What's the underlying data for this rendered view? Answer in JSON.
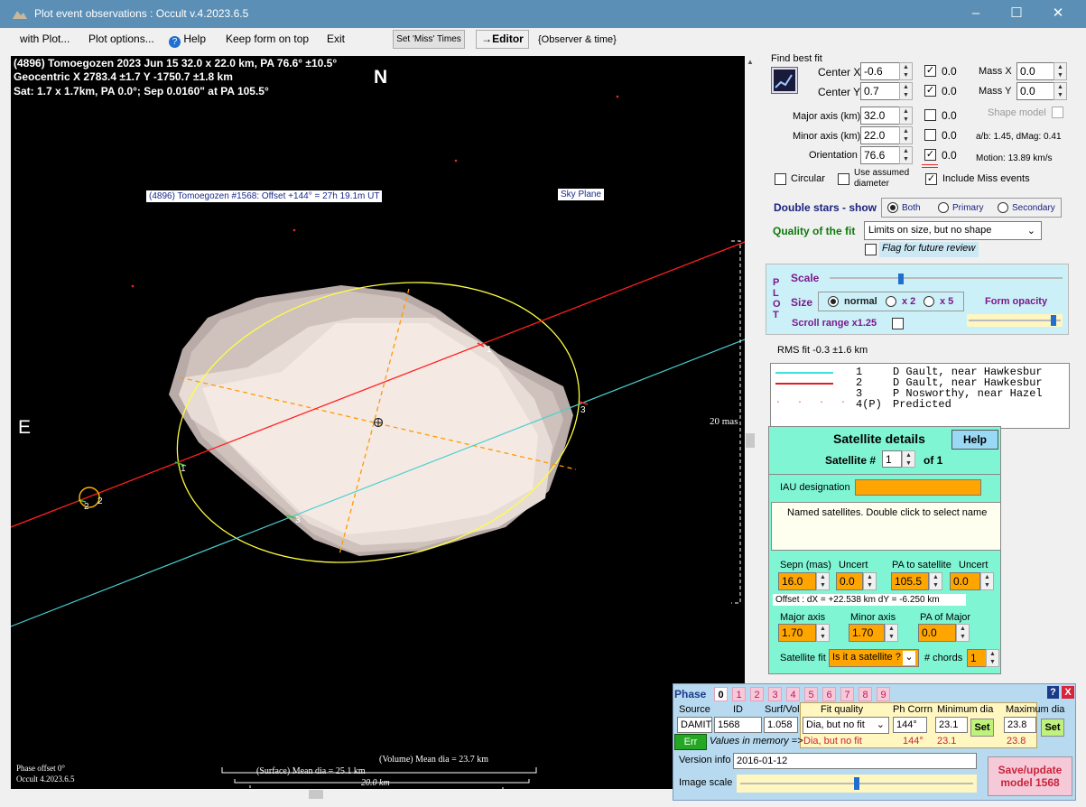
{
  "window": {
    "title": "Plot event observations : Occult v.4.2023.6.5"
  },
  "menu": {
    "with_plot": "with Plot...",
    "plot_options": "Plot options...",
    "help": "Help",
    "keep_form": "Keep form on top",
    "exit": "Exit",
    "set_miss_times": "Set 'Miss' Times",
    "editor": "→Editor",
    "observer_time": "{Observer & time}"
  },
  "plot": {
    "header_line1": "(4896) Tomoegozen  2023 Jun 15   32.0 x 22.0 km,  PA 76.6° ±10.5°",
    "header_line2": "Geocentric  X  2783.4 ±1.7  Y -1750.7 ±1.8 km",
    "header_line3": "Sat:  1.7 x 1.7km, PA 0.0°; Sep 0.0160\" at PA 105.5°",
    "north": "N",
    "east": "E",
    "shape_label": "(4896) Tomoegozen #1568: Offset +144° = 27h 19.1m UT",
    "sky_plane": "Sky Plane",
    "scale_mas": "20 mas",
    "chord_labels": [
      "1",
      "1",
      "2",
      "2",
      "3",
      "3"
    ],
    "phase_offset": "Phase offset 0°",
    "occult_version": "Occult 4.2023.6.5",
    "volume_dia": "(Volume) Mean dia = 23.7 km",
    "surface_dia": "(Surface) Mean dia = 25.1 km",
    "scale_km": "20.0 km",
    "colors": {
      "chord1": "#40e0d0",
      "chord2": "#ff2020",
      "ellipse": "#ffff40",
      "axis": "#ff9900",
      "shape": "#e2d6d0"
    }
  },
  "fit": {
    "title": "Find best fit",
    "center_x_label": "Center X",
    "center_x": "-0.6",
    "center_x_val": "0.0",
    "center_y_label": "Center Y",
    "center_y": "0.7",
    "center_y_val": "0.0",
    "major_label": "Major axis (km)",
    "major": "32.0",
    "major_val": "0.0",
    "minor_label": "Minor axis (km)",
    "minor": "22.0",
    "minor_val": "0.0",
    "orient_label": "Orientation",
    "orient": "76.6",
    "orient_val": "0.0",
    "mass_x_label": "Mass X",
    "mass_x": "0.0",
    "mass_y_label": "Mass Y",
    "mass_y": "0.0",
    "shape_model": "Shape model",
    "ab_info": "a/b: 1.45, dMag: 0.41",
    "motion": "Motion: 13.89 km/s",
    "circular": "Circular",
    "use_assumed": "Use assumed diameter",
    "include_miss": "Include Miss events",
    "double_stars": "Double stars - show",
    "both": "Both",
    "primary": "Primary",
    "secondary": "Secondary",
    "quality_label": "Quality of the fit",
    "quality_value": "Limits on size, but no shape",
    "flag_review": "Flag for future review"
  },
  "plotpanel": {
    "side": [
      "P",
      "L",
      "O",
      "T"
    ],
    "scale": "Scale",
    "size": "Size",
    "normal": "normal",
    "x2": "x 2",
    "x5": "x 5",
    "form_opacity": "Form opacity",
    "scroll_range": "Scroll range x1.25",
    "scale_pos": 0.3,
    "opacity_pos": 0.95
  },
  "rms": "RMS fit -0.3 ±1.6 km",
  "legend": [
    {
      "n": "1",
      "text": "D Gault, near Hawkesbur",
      "style": "cyan"
    },
    {
      "n": "2",
      "text": "D Gault, near Hawkesbur",
      "style": "red"
    },
    {
      "n": "3",
      "text": "P Nosworthy, near Hazel",
      "style": "none"
    },
    {
      "n": "4(P)",
      "text": "Predicted",
      "style": "dots"
    }
  ],
  "satellite": {
    "title": "Satellite details",
    "help": "Help",
    "sat_num_label": "Satellite #",
    "sat_num": "1",
    "of": "of 1",
    "iau": "IAU designation",
    "named": "Named satellites.   Double click to select name",
    "sepn_label": "Sepn (mas)",
    "sepn": "16.0",
    "uncert_label": "Uncert",
    "uncert1": "0.0",
    "pa_label": "PA to satellite",
    "pa": "105.5",
    "uncert2": "0.0",
    "offset": "Offset :  dX =  +22.538 km    dY =  -6.250 km",
    "major_label": "Major axis",
    "major": "1.70",
    "minor_label": "Minor axis",
    "minor": "1.70",
    "pa_major_label": "PA of Major",
    "pa_major": "0.0",
    "sat_fit_label": "Satellite fit",
    "sat_fit": "Is it a satellite ?",
    "chords_label": "# chords",
    "chords": "1"
  },
  "phase": {
    "title": "Phase",
    "numbers": [
      "0",
      "1",
      "2",
      "3",
      "4",
      "5",
      "6",
      "7",
      "8",
      "9"
    ],
    "source_label": "Source",
    "source": "DAMIT",
    "id_label": "ID",
    "id": "1568",
    "surfvol_label": "Surf/Vol",
    "surfvol": "1.058",
    "fit_quality_label": "Fit quality",
    "fit_quality": "Dia, but no fit",
    "fit_quality2": "Dia, but no fit",
    "ph_corrn_label": "Ph Corrn",
    "ph_corrn": "144°",
    "ph_corrn2": "144°",
    "min_dia_label": "Minimum dia",
    "min_dia": "23.1",
    "min_dia2": "23.1",
    "max_dia_label": "Maximum dia",
    "max_dia": "23.8",
    "max_dia2": "23.8",
    "set": "Set",
    "err": "Err",
    "values_mem": "Values in memory =>",
    "version_label": "Version info",
    "version": "2016-01-12",
    "image_scale": "Image scale",
    "save": "Save/update model  1568",
    "image_scale_pos": 0.5
  }
}
